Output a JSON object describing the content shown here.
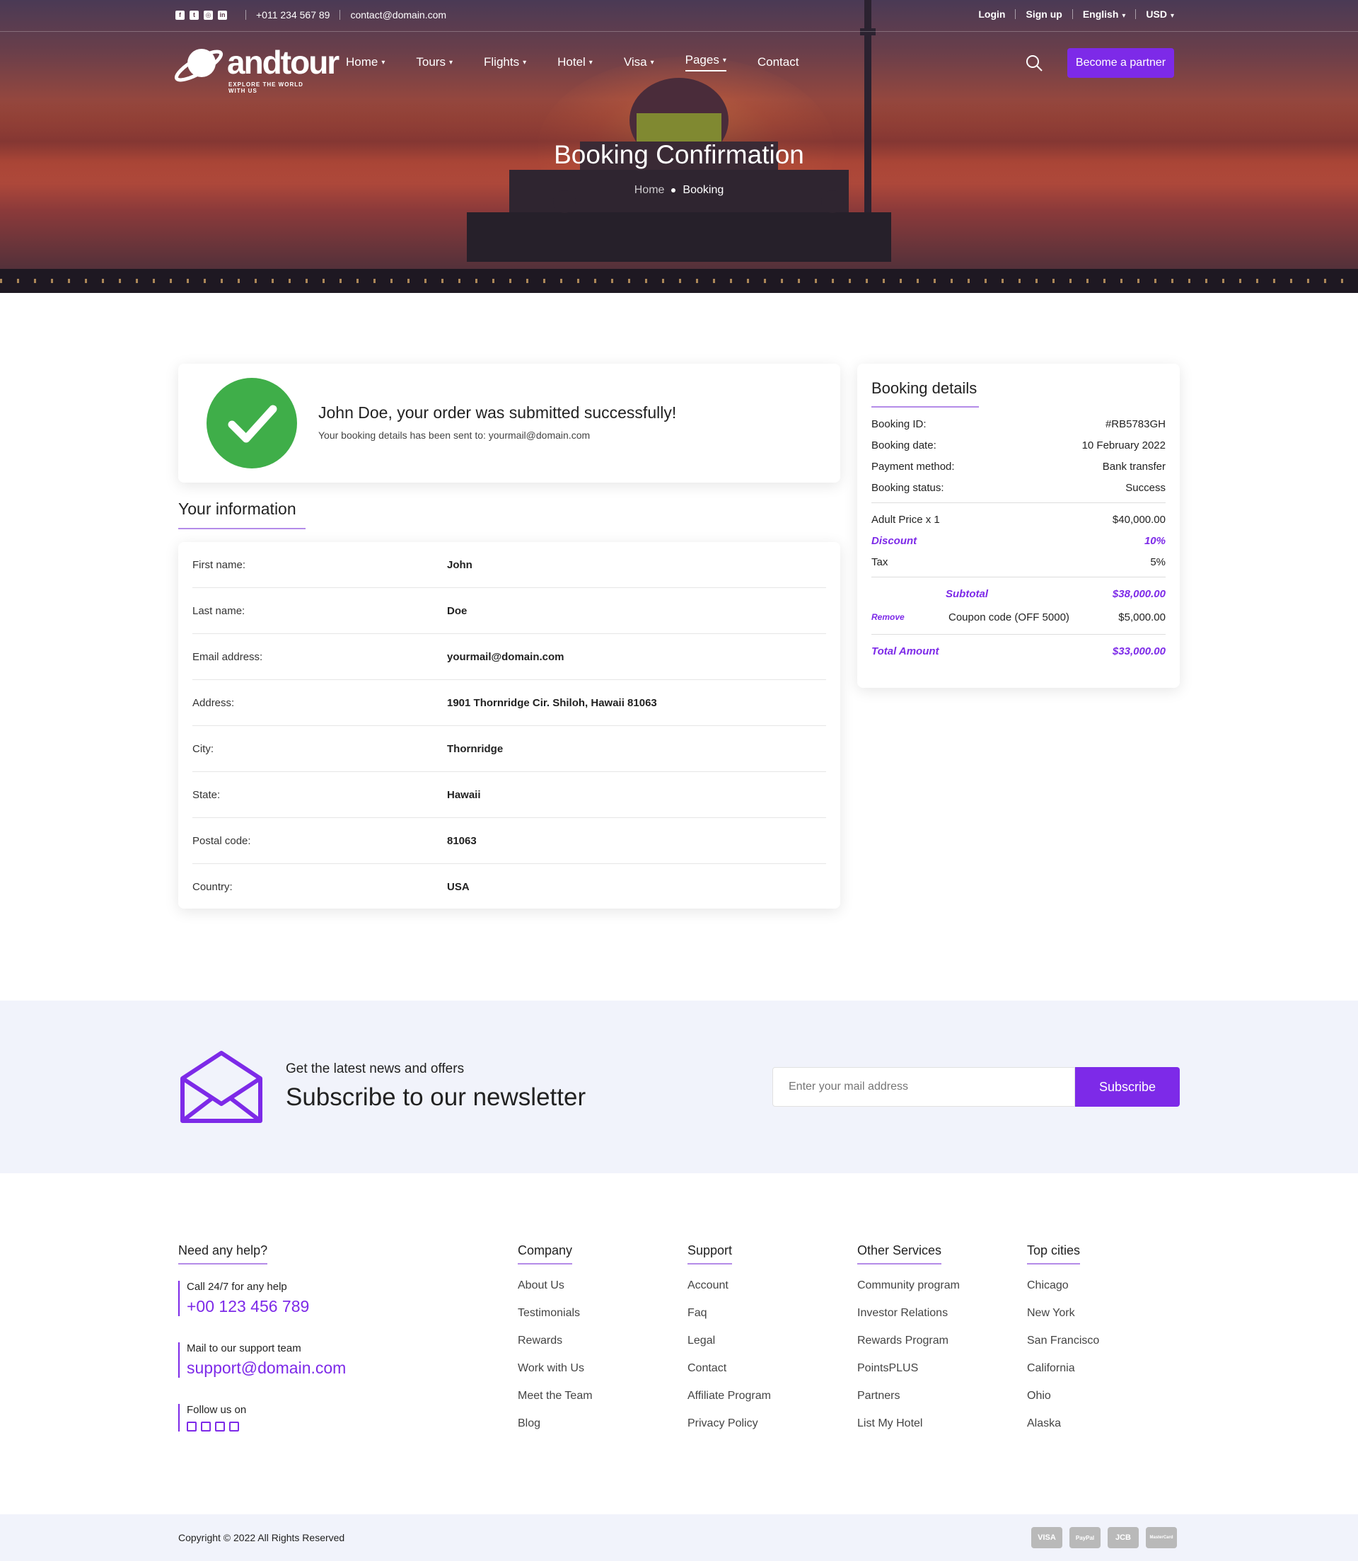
{
  "topbar": {
    "social": [
      "facebook-icon",
      "twitter-icon",
      "instagram-icon",
      "linkedin-icon"
    ],
    "phone": "+011 234 567 89",
    "email": "contact@domain.com",
    "login": "Login",
    "signup": "Sign up",
    "language": "English",
    "currency": "USD"
  },
  "nav": {
    "logo_text": "andtour",
    "logo_tagline": "EXPLORE THE WORLD WITH US",
    "items": [
      {
        "label": "Home",
        "dropdown": true
      },
      {
        "label": "Tours",
        "dropdown": true
      },
      {
        "label": "Flights",
        "dropdown": true
      },
      {
        "label": "Hotel",
        "dropdown": true
      },
      {
        "label": "Visa",
        "dropdown": true
      },
      {
        "label": "Pages",
        "dropdown": true
      },
      {
        "label": "Contact",
        "dropdown": false
      }
    ],
    "partner_button": "Become a partner"
  },
  "hero": {
    "title": "Booking Confirmation",
    "breadcrumb_home": "Home",
    "breadcrumb_current": "Booking"
  },
  "success": {
    "heading": "John Doe, your order was submitted successfully!",
    "subtext": "Your booking details has been sent to: yourmail@domain.com"
  },
  "info": {
    "title": "Your information",
    "rows": [
      {
        "label": "First name:",
        "value": "John"
      },
      {
        "label": "Last name:",
        "value": "Doe"
      },
      {
        "label": "Email address:",
        "value": "yourmail@domain.com"
      },
      {
        "label": "Address:",
        "value": "1901 Thornridge Cir. Shiloh, Hawaii 81063"
      },
      {
        "label": "City:",
        "value": "Thornridge"
      },
      {
        "label": "State:",
        "value": "Hawaii"
      },
      {
        "label": "Postal code:",
        "value": "81063"
      },
      {
        "label": "Country:",
        "value": "USA"
      }
    ]
  },
  "details": {
    "title": "Booking details",
    "booking_id_label": "Booking ID:",
    "booking_id": "#RB5783GH",
    "booking_date_label": "Booking date:",
    "booking_date": "10 February 2022",
    "payment_label": "Payment method:",
    "payment": "Bank transfer",
    "status_label": "Booking status:",
    "status": "Success",
    "adult_label": "Adult Price x 1",
    "adult": "$40,000.00",
    "discount_label": "Discount",
    "discount": "10%",
    "tax_label": "Tax",
    "tax": "5%",
    "subtotal_label": "Subtotal",
    "subtotal": "$38,000.00",
    "remove_label": "Remove",
    "coupon_label": "Coupon code (OFF 5000)",
    "coupon": "$5,000.00",
    "total_label": "Total Amount",
    "total": "$33,000.00"
  },
  "newsletter": {
    "small": "Get the latest news and offers",
    "big": "Subscribe to our newsletter",
    "placeholder": "Enter your mail address",
    "button": "Subscribe"
  },
  "footer": {
    "help_title": "Need any help?",
    "call_label": "Call 24/7 for any help",
    "call_number": "+00 123 456 789",
    "mail_label": "Mail to our support team",
    "mail": "support@domain.com",
    "follow_label": "Follow us on",
    "company_title": "Company",
    "company": [
      "About Us",
      "Testimonials",
      "Rewards",
      "Work with Us",
      "Meet the Team",
      "Blog"
    ],
    "support_title": "Support",
    "support": [
      "Account",
      "Faq",
      "Legal",
      "Contact",
      "Affiliate Program",
      "Privacy Policy"
    ],
    "services_title": "Other Services",
    "services": [
      "Community program",
      "Investor Relations",
      "Rewards Program",
      "PointsPLUS",
      "Partners",
      "List My Hotel"
    ],
    "cities_title": "Top cities",
    "cities": [
      "Chicago",
      "New York",
      "San Francisco",
      "California",
      "Ohio",
      "Alaska"
    ],
    "copyright": "Copyright © 2022 All Rights Reserved",
    "payments": [
      "VISA",
      "PayPal",
      "JCB",
      "MasterCard"
    ]
  },
  "colors": {
    "accent": "#7d2ae8",
    "success": "#3fae49",
    "newsletter_bg": "#f1f3fb"
  }
}
